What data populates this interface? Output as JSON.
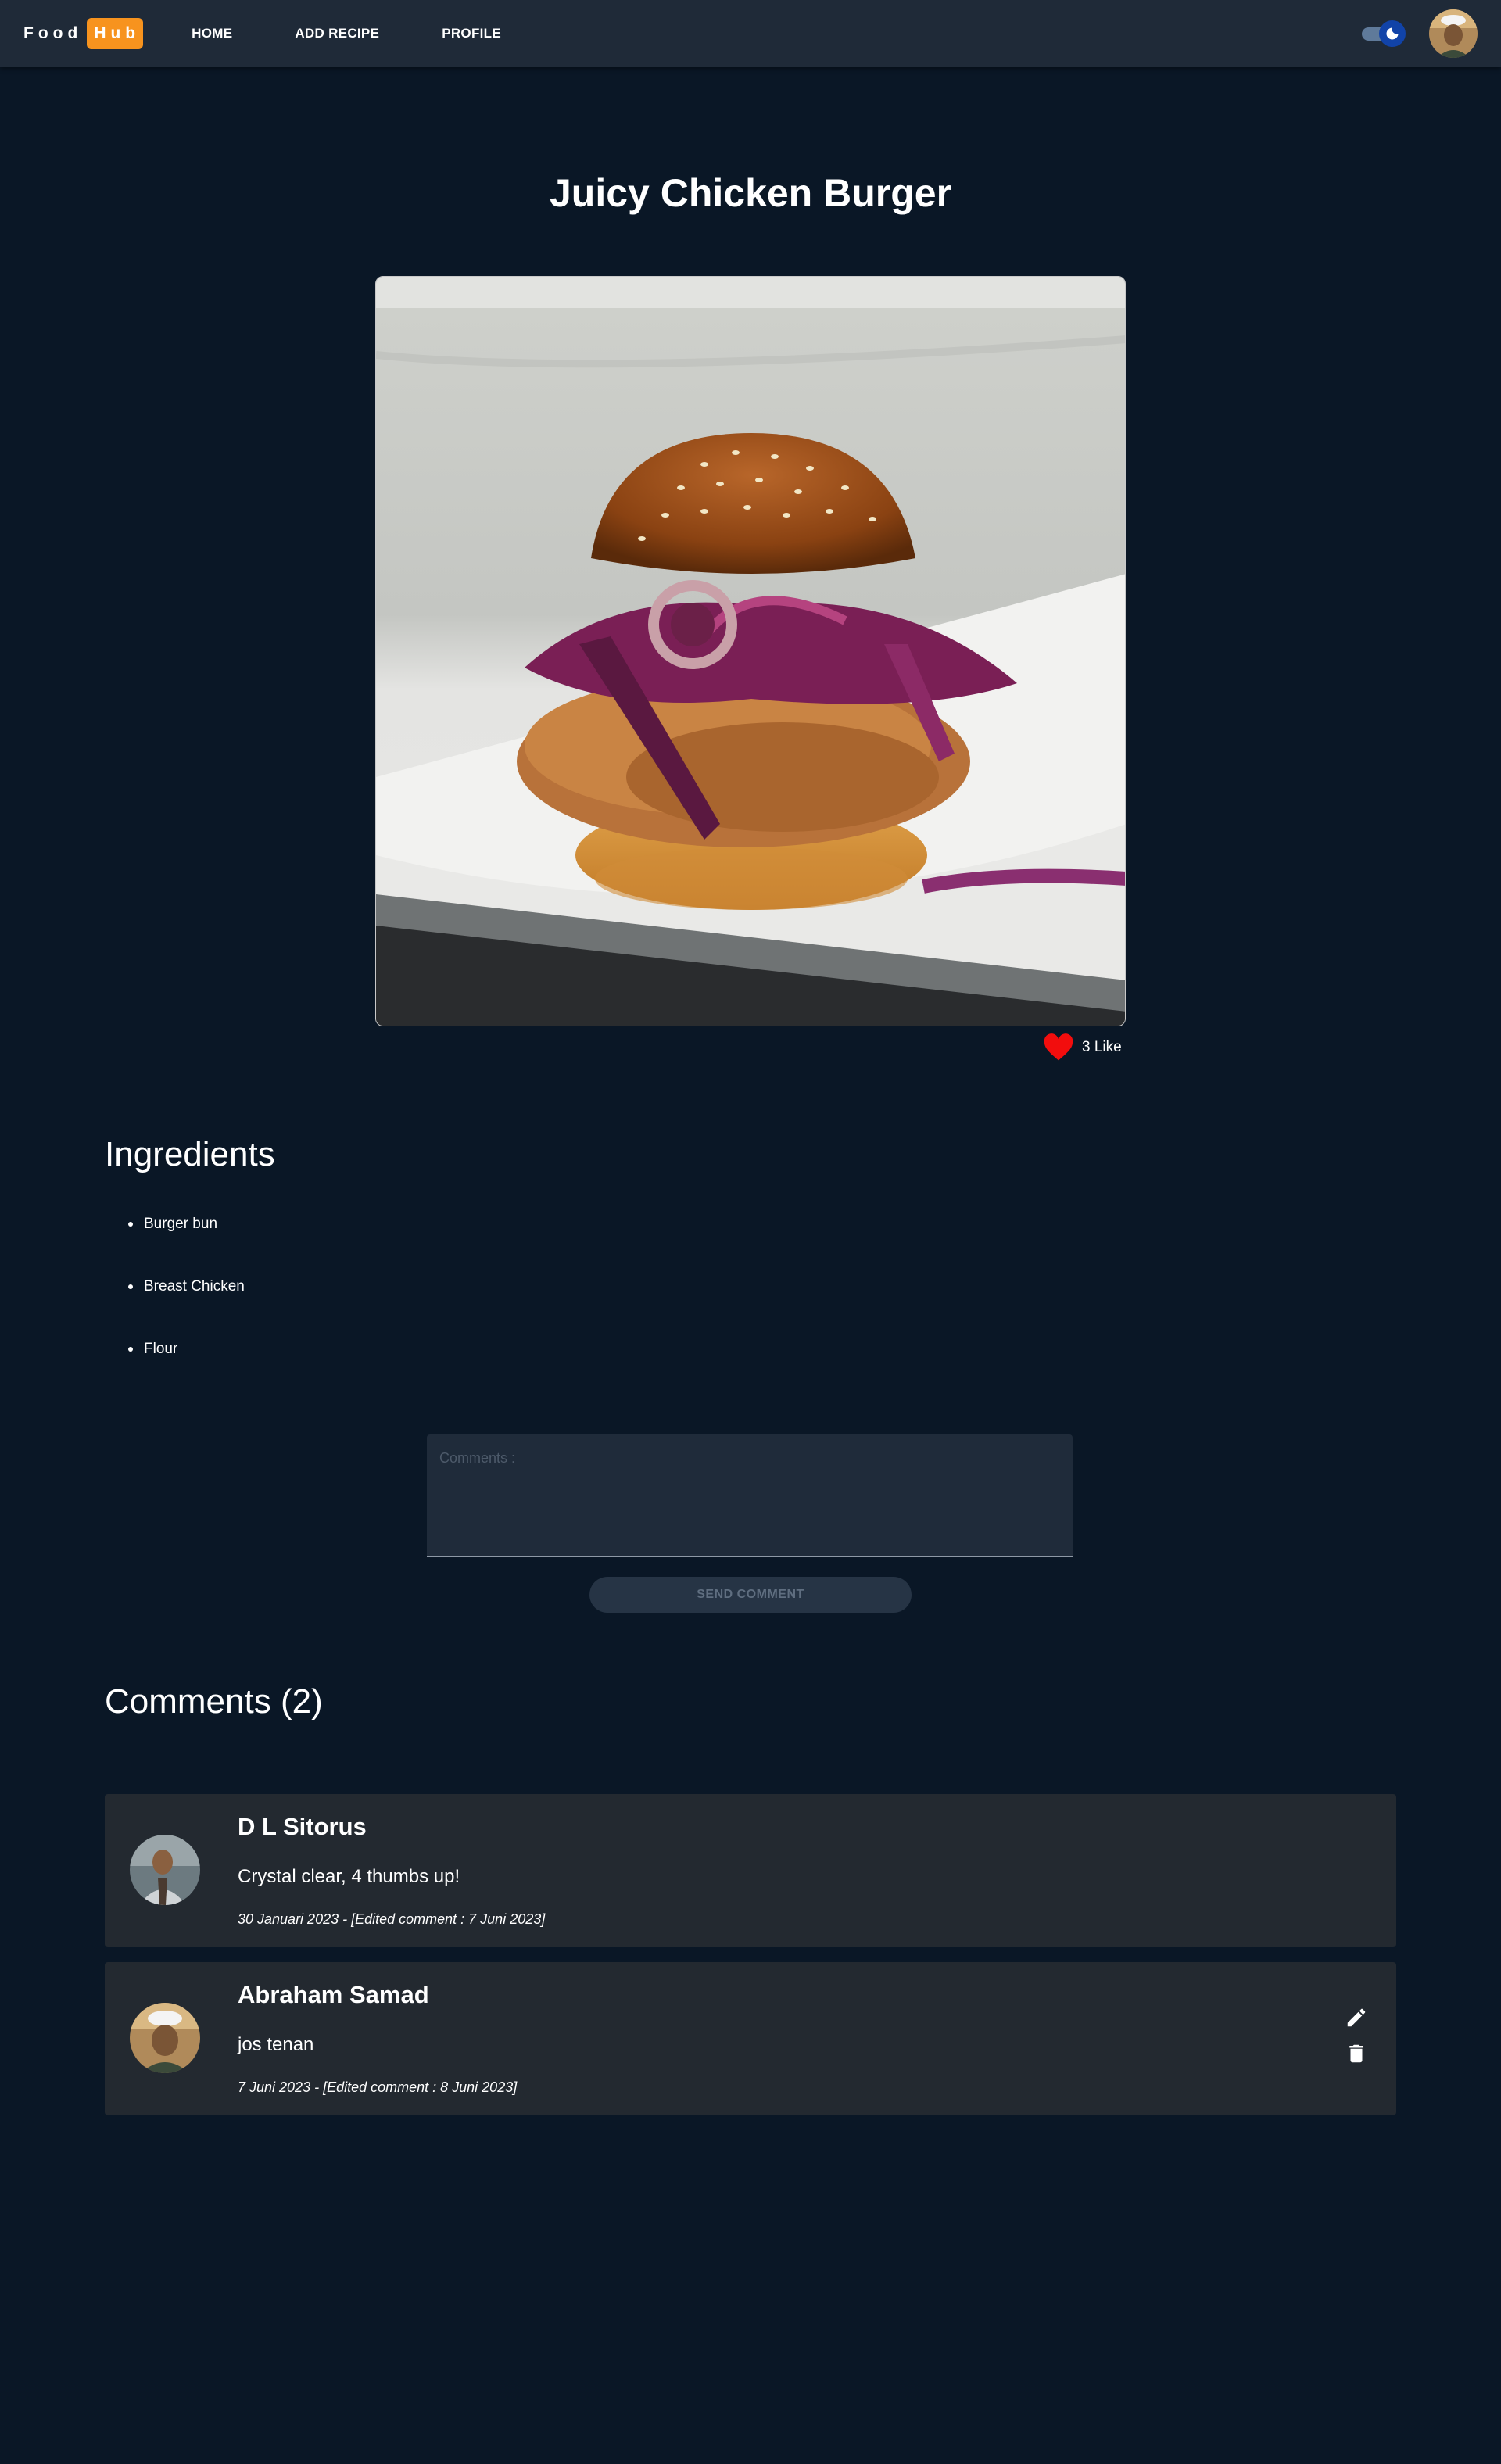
{
  "navbar": {
    "logo_food": "Food",
    "logo_hub": "Hub",
    "links": [
      "HOME",
      "ADD RECIPE",
      "PROFILE"
    ],
    "theme_toggle_state": "dark"
  },
  "recipe": {
    "title": "Juicy Chicken Burger",
    "likes_label": "3 Like",
    "like_color": "#f20d0d"
  },
  "ingredients": {
    "title": "Ingredients",
    "items": [
      "Burger bun",
      "Breast Chicken",
      "Flour"
    ]
  },
  "comment_form": {
    "placeholder": "Comments :",
    "value": "",
    "send_label": "SEND COMMENT"
  },
  "comments": {
    "title": "Comments (2)",
    "items": [
      {
        "name": "D L Sitorus",
        "text": "Crystal clear, 4 thumbs up!",
        "date": "30 Januari 2023 - [Edited comment : 7 Juni 2023]"
      },
      {
        "name": "Abraham Samad",
        "text": "jos tenan",
        "date": "7 Juni 2023 - [Edited comment : 8 Juni 2023]",
        "actions": [
          "edit-icon",
          "delete-icon"
        ]
      }
    ]
  },
  "colors": {
    "background": "#0a1726",
    "navbar": "#1f2a38",
    "accent": "#f7931e",
    "card": "#232930"
  }
}
